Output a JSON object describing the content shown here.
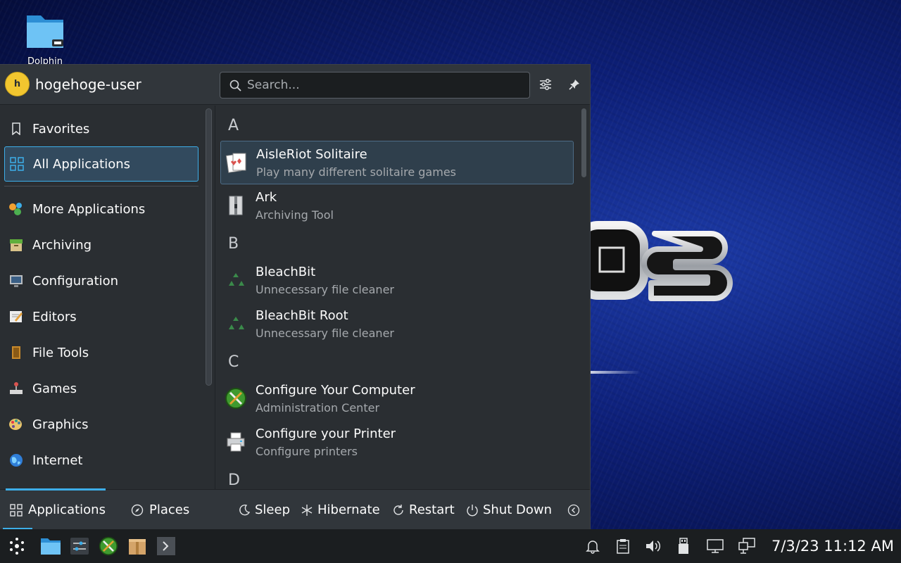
{
  "desktop": {
    "icon_label": "Dolphin"
  },
  "launcher": {
    "user": {
      "initial": "h",
      "name": "hogehoge-user"
    },
    "search": {
      "placeholder": "Search..."
    },
    "sidebar": {
      "items": [
        {
          "label": "Favorites",
          "icon": "bookmark-icon"
        },
        {
          "label": "All Applications",
          "icon": "grid-icon",
          "active": true
        },
        {
          "label": "More Applications",
          "icon": "more-apps-icon"
        },
        {
          "label": "Archiving",
          "icon": "archive-icon"
        },
        {
          "label": "Configuration",
          "icon": "configuration-icon"
        },
        {
          "label": "Editors",
          "icon": "editor-icon"
        },
        {
          "label": "File Tools",
          "icon": "file-tools-icon"
        },
        {
          "label": "Games",
          "icon": "games-icon"
        },
        {
          "label": "Graphics",
          "icon": "graphics-icon"
        },
        {
          "label": "Internet",
          "icon": "internet-icon"
        }
      ]
    },
    "sections": [
      {
        "letter": "A"
      },
      {
        "letter": "B"
      },
      {
        "letter": "C"
      },
      {
        "letter": "D"
      }
    ],
    "apps": [
      {
        "name": "AisleRiot Solitaire",
        "desc": "Play many different solitaire games"
      },
      {
        "name": "Ark",
        "desc": "Archiving Tool"
      },
      {
        "name": "BleachBit",
        "desc": "Unnecessary file cleaner"
      },
      {
        "name": "BleachBit Root",
        "desc": "Unnecessary file cleaner"
      },
      {
        "name": "Configure Your Computer",
        "desc": "Administration Center"
      },
      {
        "name": "Configure your Printer",
        "desc": "Configure printers"
      }
    ],
    "footer": {
      "tabs": [
        {
          "label": "Applications",
          "active": true
        },
        {
          "label": "Places"
        }
      ],
      "power": [
        {
          "label": "Sleep"
        },
        {
          "label": "Hibernate"
        },
        {
          "label": "Restart"
        },
        {
          "label": "Shut Down"
        }
      ]
    }
  },
  "taskbar": {
    "clock": "7/3/23  11:12 AM"
  },
  "colors": {
    "accent": "#3daee9",
    "panel": "#2a2e32",
    "taskbar": "#1b1e20"
  }
}
